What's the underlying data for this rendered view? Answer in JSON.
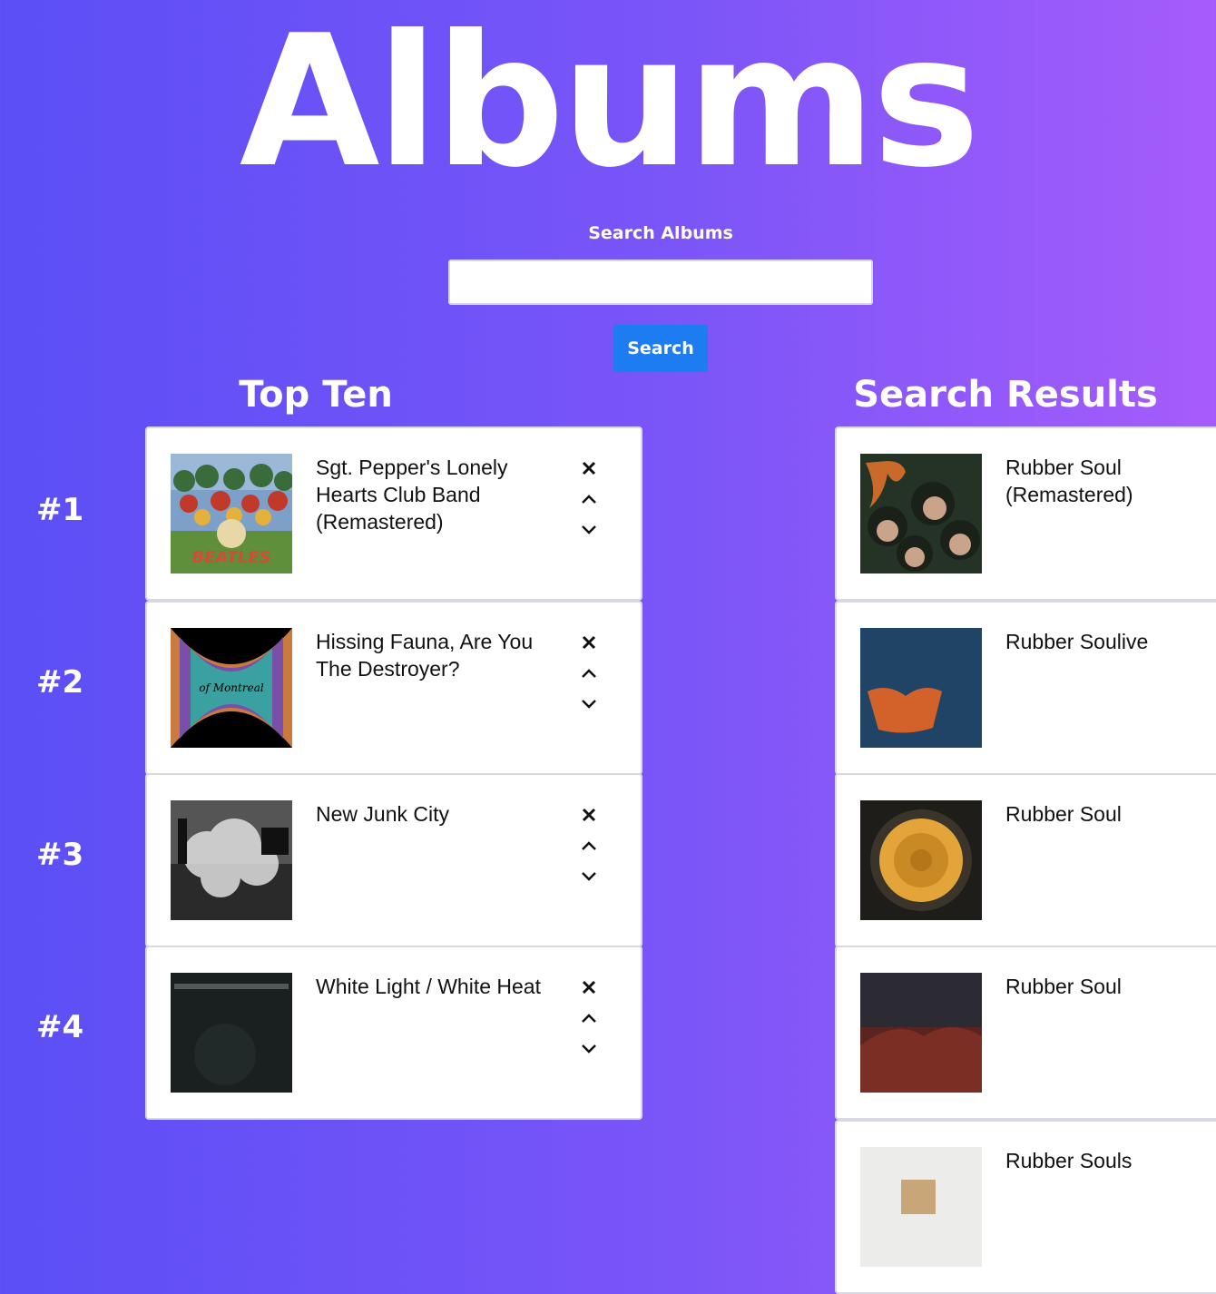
{
  "page": {
    "title": "Albums",
    "search": {
      "label": "Search Albums",
      "value": "",
      "placeholder": "",
      "button_label": "Search"
    }
  },
  "top_ten": {
    "title": "Top Ten",
    "items": [
      {
        "rank": "#1",
        "title": "Sgt. Pepper's Lonely Hearts Club Band (Remastered)"
      },
      {
        "rank": "#2",
        "title": "Hissing Fauna, Are You The Destroyer?"
      },
      {
        "rank": "#3",
        "title": "New Junk City"
      },
      {
        "rank": "#4",
        "title": "White Light / White Heat"
      }
    ],
    "controls": {
      "remove": "close-icon",
      "up": "chevron-up-icon",
      "down": "chevron-down-icon"
    }
  },
  "search_results": {
    "title": "Search Results",
    "items": [
      {
        "title": "Rubber Soul (Remastered)"
      },
      {
        "title": "Rubber Soulive"
      },
      {
        "title": "Rubber Soul"
      },
      {
        "title": "Rubber Soul"
      },
      {
        "title": "Rubber Souls"
      }
    ]
  },
  "colors": {
    "gradient_start": "#5b4ff6",
    "gradient_end": "#a65cfb",
    "button": "#1e7cf3"
  }
}
